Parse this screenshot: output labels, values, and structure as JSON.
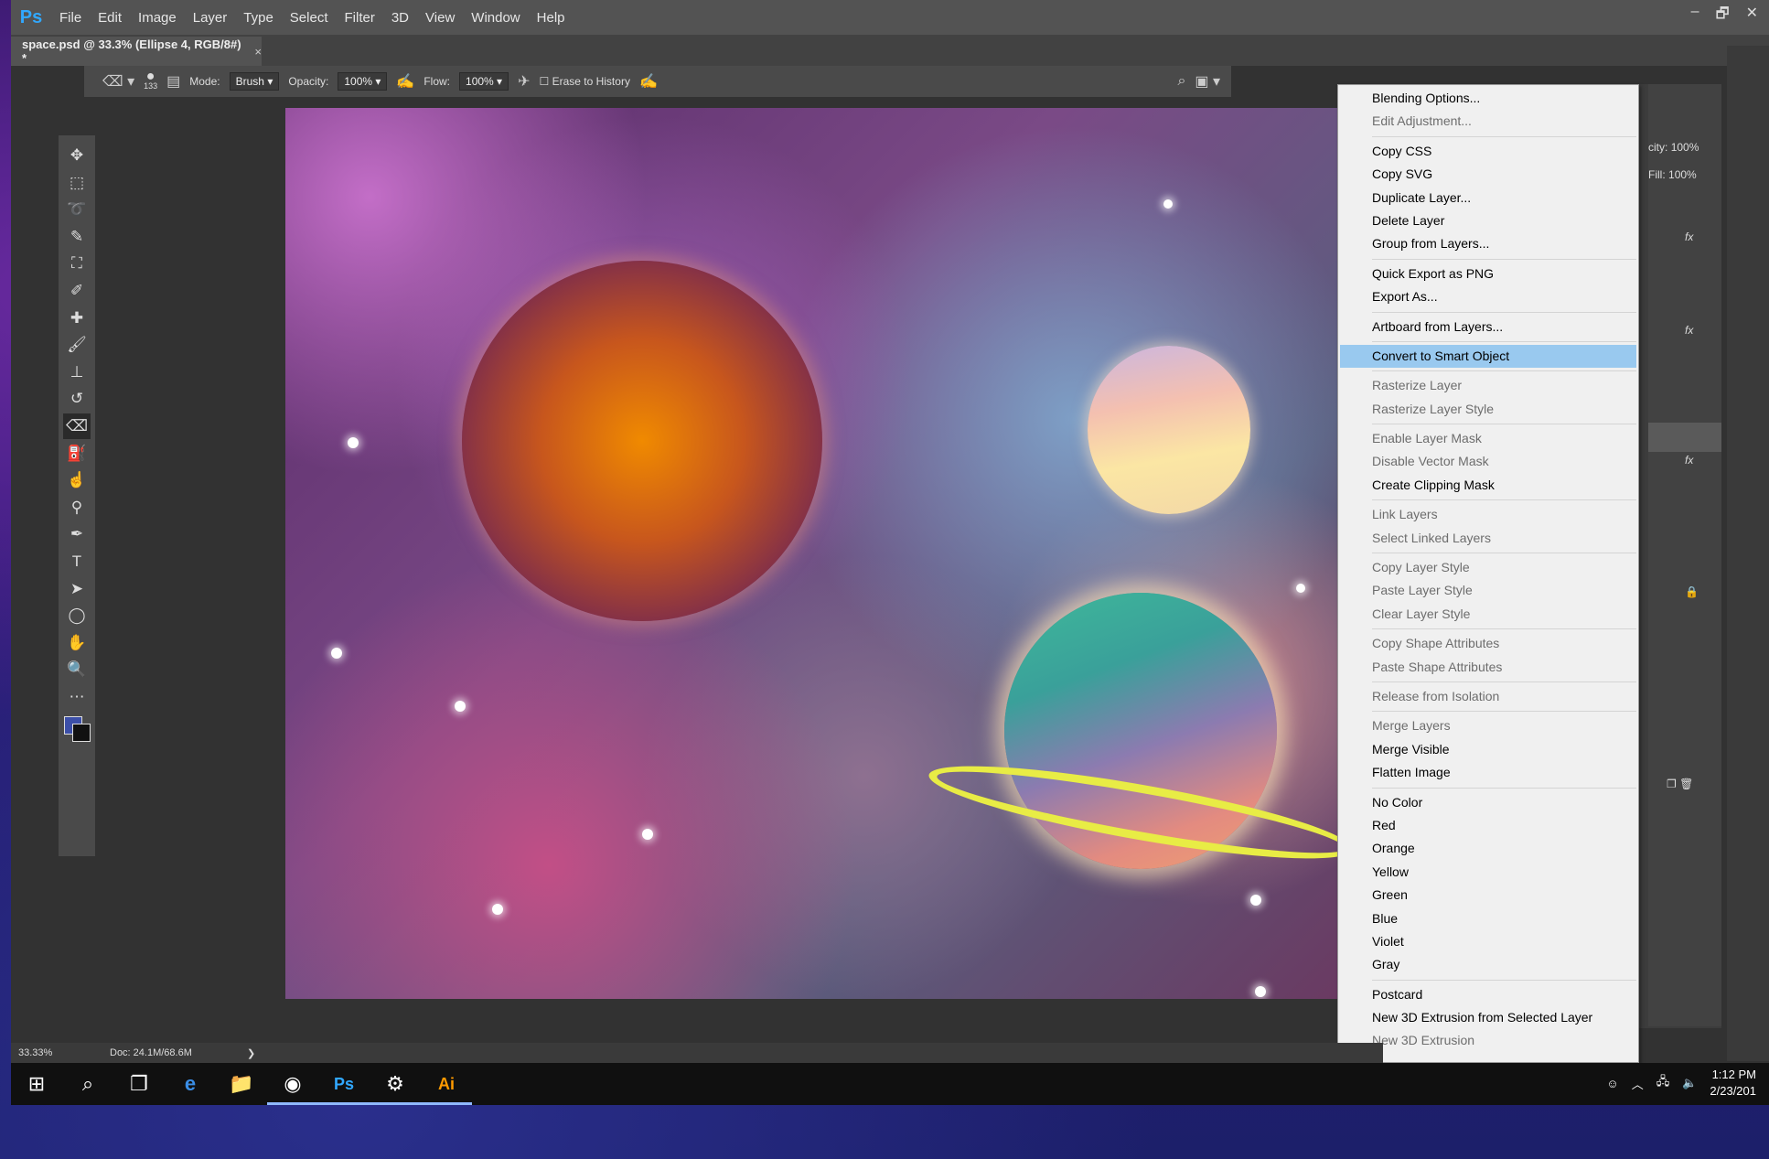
{
  "app": {
    "logo": "Ps",
    "menu": [
      "File",
      "Edit",
      "Image",
      "Layer",
      "Type",
      "Select",
      "Filter",
      "3D",
      "View",
      "Window",
      "Help"
    ],
    "window_controls": [
      "–",
      "🗗",
      "✕"
    ]
  },
  "document_tab": {
    "title": "space.psd @ 33.3% (Ellipse 4, RGB/8#) *",
    "close": "×"
  },
  "options_bar": {
    "brush_size": "133",
    "mode_label": "Mode:",
    "mode_value": "Brush",
    "opacity_label": "Opacity:",
    "opacity_value": "100%",
    "flow_label": "Flow:",
    "flow_value": "100%",
    "erase_to_history": "Erase to History"
  },
  "tools": [
    "move",
    "marquee",
    "lasso",
    "quick-select",
    "crop",
    "eyedropper",
    "healing",
    "brush",
    "stamp",
    "history-brush",
    "eraser",
    "paint-bucket",
    "smudge",
    "dodge",
    "pen",
    "type",
    "path-select",
    "ellipse",
    "hand",
    "zoom",
    "more"
  ],
  "tool_glyphs": [
    "✥",
    "⬚",
    "➰",
    "✎",
    "⛶",
    "✐",
    "✚",
    "🖌",
    "⊥",
    "↺",
    "⌫",
    "⛽",
    "☝",
    "⚲",
    "✒",
    "T",
    "➤",
    "◯",
    "✋",
    "🔍",
    "⋯"
  ],
  "colors": {
    "foreground": "#3c4fa8",
    "background": "#111111",
    "menu_highlight": "#99c9ef",
    "ring": "#e8ec45"
  },
  "layers_panel": {
    "opacity_label": "city:",
    "opacity_value": "100%",
    "fill_label": "Fill:",
    "fill_value": "100%",
    "fx": "fx"
  },
  "context_menu": {
    "groups": [
      [
        {
          "label": "Blending Options...",
          "enabled": true
        },
        {
          "label": "Edit Adjustment...",
          "enabled": false
        }
      ],
      [
        {
          "label": "Copy CSS",
          "enabled": true
        },
        {
          "label": "Copy SVG",
          "enabled": true
        },
        {
          "label": "Duplicate Layer...",
          "enabled": true
        },
        {
          "label": "Delete Layer",
          "enabled": true
        },
        {
          "label": "Group from Layers...",
          "enabled": true
        }
      ],
      [
        {
          "label": "Quick Export as PNG",
          "enabled": true
        },
        {
          "label": "Export As...",
          "enabled": true
        }
      ],
      [
        {
          "label": "Artboard from Layers...",
          "enabled": true
        }
      ],
      [
        {
          "label": "Convert to Smart Object",
          "enabled": true,
          "selected": true
        }
      ],
      [
        {
          "label": "Rasterize Layer",
          "enabled": false
        },
        {
          "label": "Rasterize Layer Style",
          "enabled": false
        }
      ],
      [
        {
          "label": "Enable Layer Mask",
          "enabled": false
        },
        {
          "label": "Disable Vector Mask",
          "enabled": false
        },
        {
          "label": "Create Clipping Mask",
          "enabled": true
        }
      ],
      [
        {
          "label": "Link Layers",
          "enabled": false
        },
        {
          "label": "Select Linked Layers",
          "enabled": false
        }
      ],
      [
        {
          "label": "Copy Layer Style",
          "enabled": false
        },
        {
          "label": "Paste Layer Style",
          "enabled": false
        },
        {
          "label": "Clear Layer Style",
          "enabled": false
        }
      ],
      [
        {
          "label": "Copy Shape Attributes",
          "enabled": false
        },
        {
          "label": "Paste Shape Attributes",
          "enabled": false
        }
      ],
      [
        {
          "label": "Release from Isolation",
          "enabled": false
        }
      ],
      [
        {
          "label": "Merge Layers",
          "enabled": false
        },
        {
          "label": "Merge Visible",
          "enabled": true
        },
        {
          "label": "Flatten Image",
          "enabled": true
        }
      ],
      [
        {
          "label": "No Color",
          "enabled": true
        },
        {
          "label": "Red",
          "enabled": true
        },
        {
          "label": "Orange",
          "enabled": true
        },
        {
          "label": "Yellow",
          "enabled": true
        },
        {
          "label": "Green",
          "enabled": true
        },
        {
          "label": "Blue",
          "enabled": true
        },
        {
          "label": "Violet",
          "enabled": true
        },
        {
          "label": "Gray",
          "enabled": true
        }
      ],
      [
        {
          "label": "Postcard",
          "enabled": true
        },
        {
          "label": "New 3D Extrusion from Selected Layer",
          "enabled": true
        },
        {
          "label": "New 3D Extrusion",
          "enabled": false
        }
      ]
    ]
  },
  "status_bar": {
    "zoom": "33.33%",
    "doc": "Doc: 24.1M/68.6M",
    "arrow": "❯"
  },
  "taskbar": {
    "apps": [
      {
        "name": "start-icon",
        "glyph": "⊞"
      },
      {
        "name": "search-icon",
        "glyph": "⌕"
      },
      {
        "name": "task-view-icon",
        "glyph": "❐"
      },
      {
        "name": "edge-icon",
        "glyph": "e"
      },
      {
        "name": "file-explorer-icon",
        "glyph": "📁"
      },
      {
        "name": "chrome-icon",
        "glyph": "◉"
      },
      {
        "name": "photoshop-icon",
        "glyph": "Ps"
      },
      {
        "name": "settings-icon",
        "glyph": "⚙"
      },
      {
        "name": "illustrator-icon",
        "glyph": "Ai"
      }
    ],
    "time": "1:12 PM",
    "date": "2/23/201"
  }
}
